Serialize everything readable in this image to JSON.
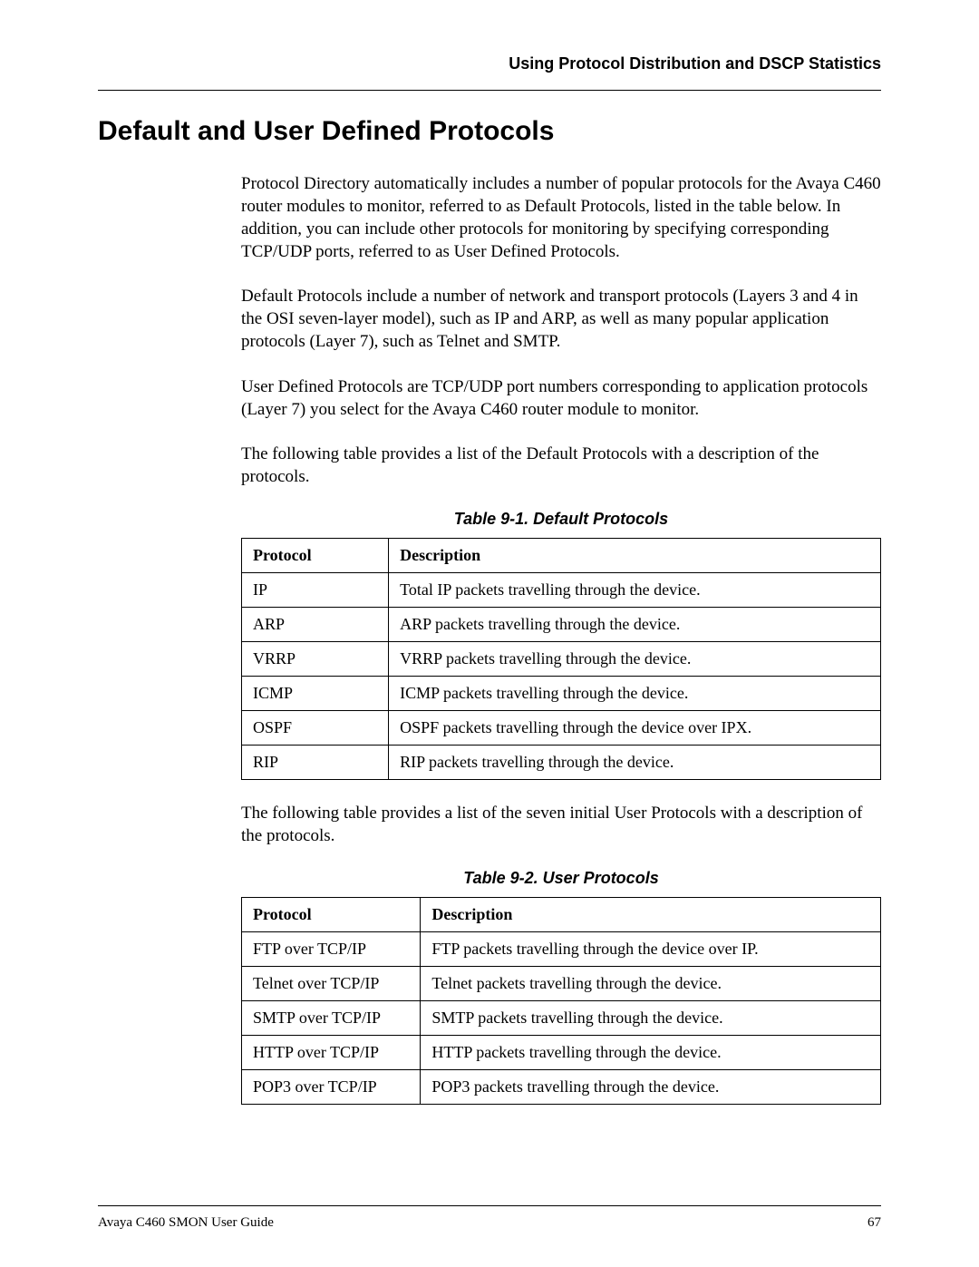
{
  "header": {
    "right": "Using Protocol Distribution and DSCP Statistics"
  },
  "section_title": "Default and User Defined Protocols",
  "paragraphs": {
    "p1": "Protocol Directory automatically includes a number of popular protocols for the Avaya C460 router modules to monitor, referred to as Default Protocols, listed in the table below. In addition, you can include other protocols for monitoring by specifying corresponding TCP/UDP ports, referred to as User Defined Protocols.",
    "p2": "Default Protocols include a number of network and transport protocols (Layers 3 and 4 in the OSI seven-layer model), such as IP and ARP, as well as many popular application protocols (Layer 7), such as Telnet and SMTP.",
    "p3": "User Defined Protocols are TCP/UDP port numbers corresponding to application protocols (Layer 7) you select for the Avaya C460 router module to monitor.",
    "p4": "The following table provides a list of the Default Protocols with a description of the protocols.",
    "p5": "The following table provides a list of the seven initial User Protocols with a description of the protocols."
  },
  "table1": {
    "caption": "Table 9-1.  Default Protocols",
    "headers": {
      "c1": "Protocol",
      "c2": "Description"
    },
    "rows": [
      {
        "c1": "IP",
        "c2": "Total IP packets travelling through the device."
      },
      {
        "c1": "ARP",
        "c2": "ARP packets travelling through the device."
      },
      {
        "c1": "VRRP",
        "c2": "VRRP packets travelling through the device."
      },
      {
        "c1": "ICMP",
        "c2": "ICMP packets travelling through the device."
      },
      {
        "c1": "OSPF",
        "c2": "OSPF packets travelling through the device over IPX."
      },
      {
        "c1": "RIP",
        "c2": "RIP packets travelling through the device."
      }
    ]
  },
  "table2": {
    "caption": "Table 9-2.  User Protocols",
    "headers": {
      "c1": "Protocol",
      "c2": "Description"
    },
    "rows": [
      {
        "c1": "FTP over TCP/IP",
        "c2": "FTP packets travelling through the device over IP."
      },
      {
        "c1": "Telnet over TCP/IP",
        "c2": "Telnet packets travelling through the device."
      },
      {
        "c1": "SMTP over TCP/IP",
        "c2": "SMTP packets travelling through the device."
      },
      {
        "c1": "HTTP over TCP/IP",
        "c2": "HTTP packets travelling through the device."
      },
      {
        "c1": "POP3 over TCP/IP",
        "c2": "POP3 packets travelling through the device."
      }
    ]
  },
  "footer": {
    "left": "Avaya C460 SMON User Guide",
    "right": "67"
  }
}
